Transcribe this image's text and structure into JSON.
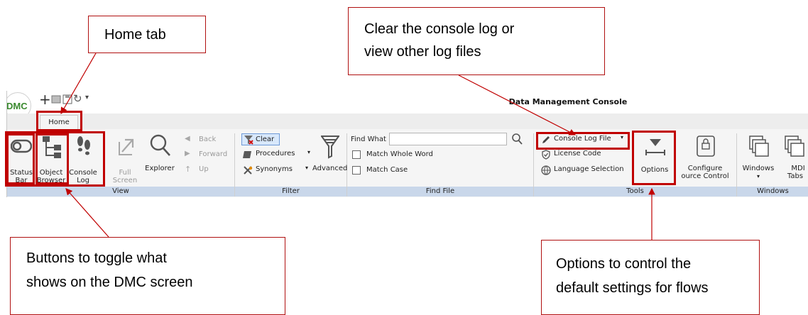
{
  "callouts": {
    "home_tab": "Home tab",
    "console_log": [
      "Clear the console log or",
      "view other log files"
    ],
    "toggle_buttons": [
      "Buttons to toggle what",
      "shows on the DMC screen"
    ],
    "options": [
      "Options to control the",
      "default settings for flows"
    ]
  },
  "app": {
    "logo": "DMC",
    "title": "Data Management Console",
    "tab_home": "Home"
  },
  "groups": {
    "view": {
      "label": "View",
      "status_bar": [
        "Status",
        "Bar"
      ],
      "object_browser": [
        "Object",
        "Browser"
      ],
      "console_log": [
        "Console",
        "Log"
      ],
      "full_screen": [
        "Full",
        "Screen"
      ],
      "explorer": "Explorer",
      "back": "Back",
      "forward": "Forward",
      "up": "Up"
    },
    "filter": {
      "label": "Filter",
      "clear": "Clear",
      "procedures": "Procedures",
      "synonyms": "Synonyms",
      "advanced": "Advanced"
    },
    "find_file": {
      "label": "Find File",
      "find_what": "Find What",
      "find_value": "",
      "match_whole_word": "Match Whole Word",
      "match_case": "Match Case"
    },
    "tools": {
      "label": "Tools",
      "console_log_file": "Console Log File",
      "license_code": "License Code",
      "language_selection": "Language Selection",
      "options": "Options",
      "configure_source_control": [
        "Configure",
        "ource Control"
      ]
    },
    "windows": {
      "label": "Windows",
      "windows": "Windows",
      "mdi_tabs": [
        "MDI",
        "Tabs"
      ]
    }
  },
  "colors": {
    "highlight": "#c00000",
    "group_bar": "#c9d7ea",
    "logo_green": "#3b8a2f"
  }
}
